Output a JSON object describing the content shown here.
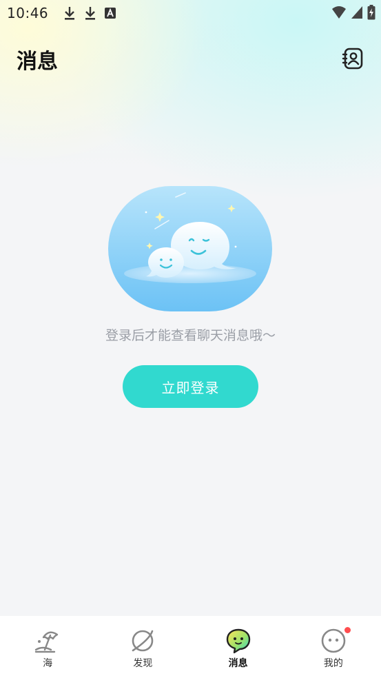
{
  "status_bar": {
    "time": "10:46",
    "left_icons": [
      "download-icon",
      "download-icon",
      "text-a-icon"
    ],
    "right_icons": [
      "wifi-icon",
      "signal-icon",
      "battery-charging-icon"
    ]
  },
  "header": {
    "title": "消息",
    "contacts_icon": "contacts-book-icon"
  },
  "empty_state": {
    "illustration": "chat-bubbles-illustration",
    "hint": "登录后才能查看聊天消息哦～",
    "login_label": "立即登录"
  },
  "bottom_nav": {
    "items": [
      {
        "label": "海",
        "icon": "beach-umbrella-icon",
        "active": false
      },
      {
        "label": "发现",
        "icon": "planet-icon",
        "active": false
      },
      {
        "label": "消息",
        "icon": "message-bubble-icon",
        "active": true
      },
      {
        "label": "我的",
        "icon": "face-icon",
        "active": false,
        "badge": true
      }
    ]
  },
  "colors": {
    "accent": "#31d9cf",
    "badge": "#ff4d4f",
    "hint_text": "#9a9ea6"
  }
}
